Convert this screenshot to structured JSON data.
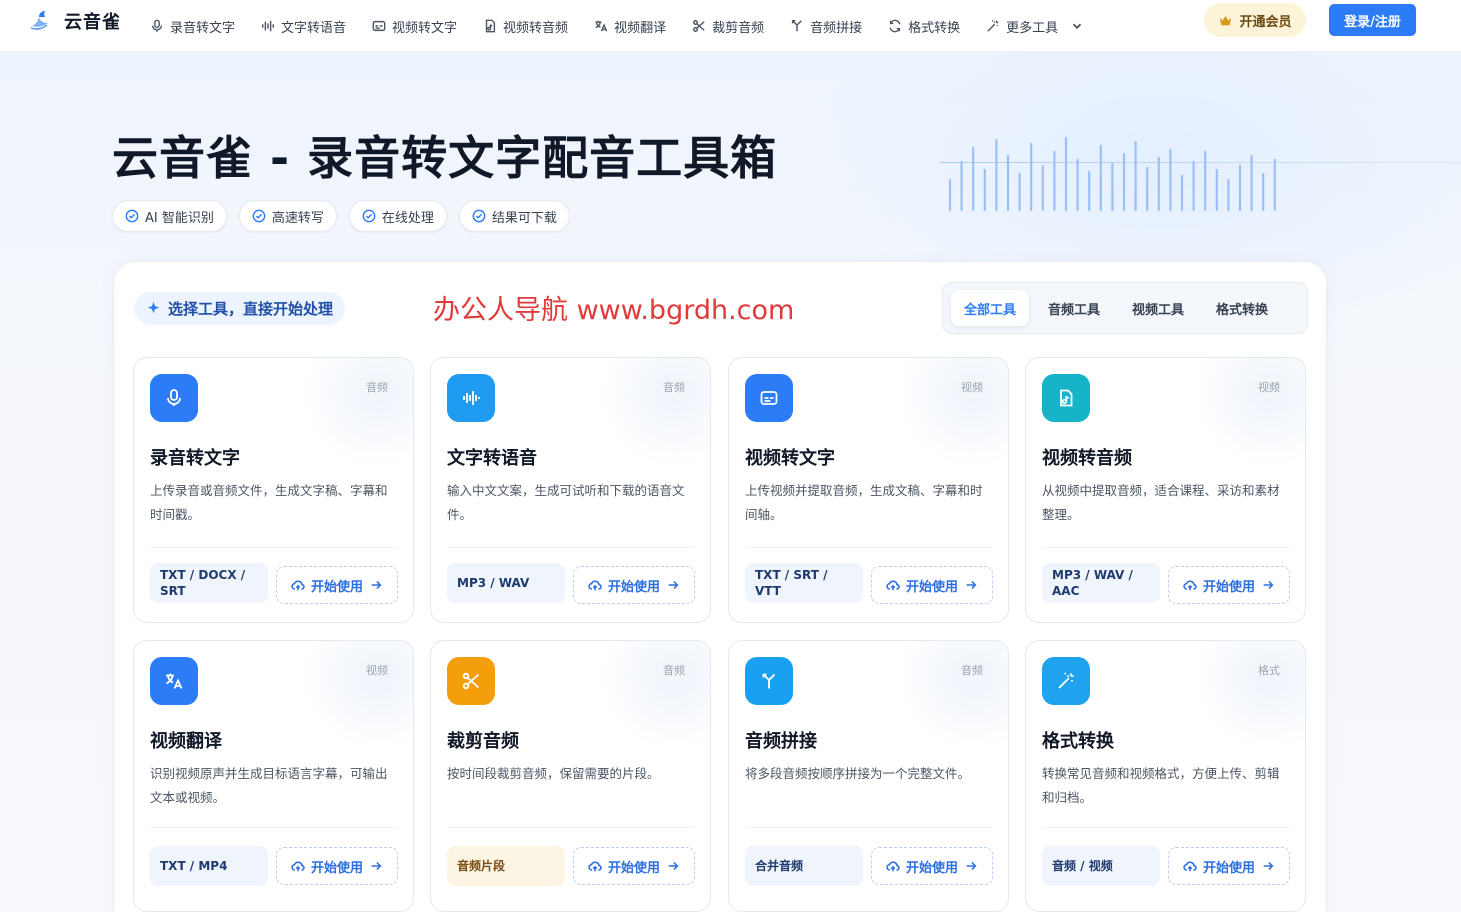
{
  "nav": {
    "brand": "云音雀",
    "items": [
      {
        "label": "录音转文字",
        "icon": "mic-icon"
      },
      {
        "label": "文字转语音",
        "icon": "waveform-icon"
      },
      {
        "label": "视频转文字",
        "icon": "subtitle-icon"
      },
      {
        "label": "视频转音频",
        "icon": "file-audio-icon"
      },
      {
        "label": "视频翻译",
        "icon": "translate-icon"
      },
      {
        "label": "裁剪音频",
        "icon": "scissors-icon"
      },
      {
        "label": "音频拼接",
        "icon": "merge-icon"
      },
      {
        "label": "格式转换",
        "icon": "refresh-icon"
      },
      {
        "label": "更多工具",
        "icon": "magic-wand-icon"
      }
    ],
    "vip_label": "开通会员",
    "login_label": "登录/注册"
  },
  "hero": {
    "title": "云音雀 - 录音转文字配音工具箱",
    "pills": [
      "AI 智能识别",
      "高速转写",
      "在线处理",
      "结果可下载"
    ]
  },
  "panel": {
    "select_label": "选择工具，直接开始处理",
    "watermark": "办公人导航 www.bgrdh.com",
    "tabs": [
      "全部工具",
      "音频工具",
      "视频工具",
      "格式转换"
    ],
    "active_tab": "全部工具"
  },
  "cards": [
    {
      "title": "录音转文字",
      "badge": "音频",
      "desc": "上传录音或音频文件，生成文字稿、字幕和时间戳。",
      "formats": "TXT / DOCX / SRT",
      "button": "开始使用",
      "icon": "mic-icon",
      "color": "#2b7cf6"
    },
    {
      "title": "文字转语音",
      "badge": "音频",
      "desc": "输入中文文案，生成可试听和下载的语音文件。",
      "formats": "MP3 / WAV",
      "button": "开始使用",
      "icon": "waveform-icon",
      "color": "#1f9bf2"
    },
    {
      "title": "视频转文字",
      "badge": "视频",
      "desc": "上传视频并提取音频，生成文稿、字幕和时间轴。",
      "formats": "TXT / SRT / VTT",
      "button": "开始使用",
      "icon": "subtitle-icon",
      "color": "#2b7cf6"
    },
    {
      "title": "视频转音频",
      "badge": "视频",
      "desc": "从视频中提取音频，适合课程、采访和素材整理。",
      "formats": "MP3 / WAV / AAC",
      "button": "开始使用",
      "icon": "file-audio-icon",
      "color": "#17b3c9"
    },
    {
      "title": "视频翻译",
      "badge": "视频",
      "desc": "识别视频原声并生成目标语言字幕，可输出文本或视频。",
      "formats": "TXT / MP4",
      "button": "开始使用",
      "icon": "translate-icon",
      "color": "#2b7cf6"
    },
    {
      "title": "裁剪音频",
      "badge": "音频",
      "desc": "按时间段裁剪音频，保留需要的片段。",
      "formats": "音频片段",
      "button": "开始使用",
      "icon": "scissors-icon",
      "color": "#f59e0b"
    },
    {
      "title": "音频拼接",
      "badge": "音频",
      "desc": "将多段音频按顺序拼接为一个完整文件。",
      "formats": "合并音频",
      "button": "开始使用",
      "icon": "merge-icon",
      "color": "#1aa0f0"
    },
    {
      "title": "格式转换",
      "badge": "格式",
      "desc": "转换常见音频和视频格式，方便上传、剪辑和归档。",
      "formats": "音频 / 视频",
      "button": "开始使用",
      "icon": "magic-wand-icon",
      "color": "#1fa3ee"
    }
  ]
}
